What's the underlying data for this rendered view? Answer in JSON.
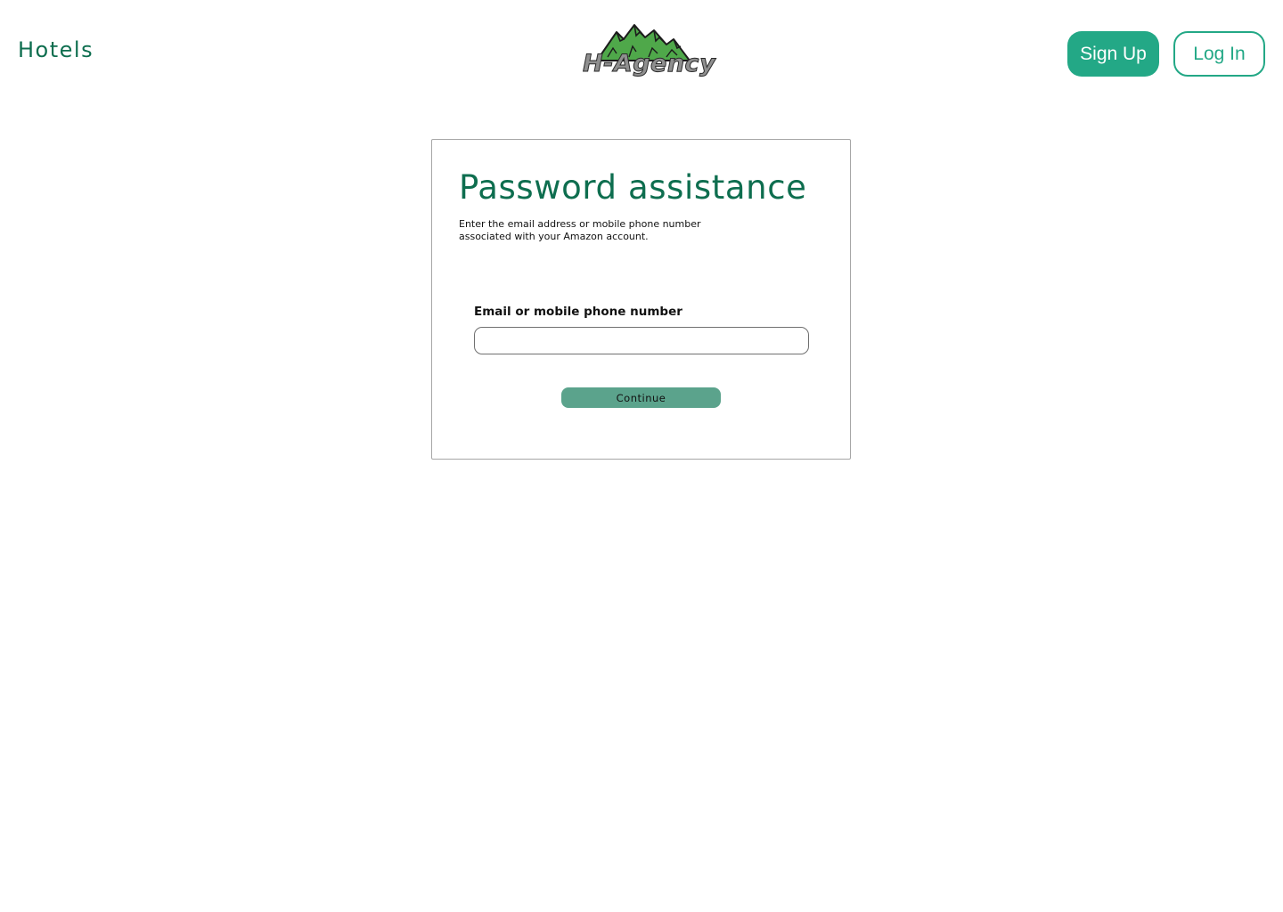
{
  "header": {
    "nav_link": "Hotels",
    "logo_text": "H-Agency",
    "signup_label": "Sign Up",
    "login_label": "Log In"
  },
  "card": {
    "title": "Password assistance",
    "description": "Enter the email address or mobile phone number associated with your Amazon account.",
    "field_label": "Email or mobile phone number",
    "field_value": "",
    "field_placeholder": "",
    "continue_label": "Continue"
  },
  "colors": {
    "brand_green": "#0e6e4f",
    "accent_teal": "#23a886",
    "continue_button": "#5ba38c",
    "logo_mountain_green": "#4fa84a"
  },
  "icons": {
    "logo_mark": "mountains-icon"
  }
}
